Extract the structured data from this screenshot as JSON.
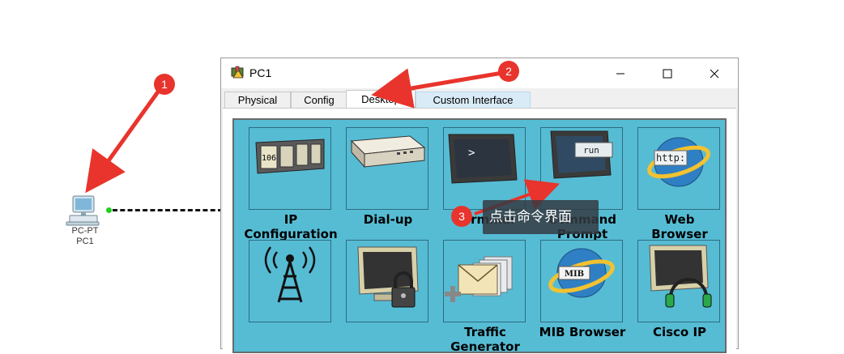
{
  "workspace": {
    "device_type": "PC-PT",
    "device_name": "PC1"
  },
  "window": {
    "title": "PC1",
    "tabs": [
      {
        "label": "Physical"
      },
      {
        "label": "Config"
      },
      {
        "label": "Desktop"
      },
      {
        "label": "Custom Interface"
      }
    ],
    "active_tab": "Desktop"
  },
  "desktop": {
    "apps": [
      {
        "label": "IP\nConfiguration",
        "icon": "ip-config-icon"
      },
      {
        "label": "Dial-up",
        "icon": "dialup-modem-icon"
      },
      {
        "label": "Terminal",
        "icon": "terminal-icon"
      },
      {
        "label": "Command\nPrompt",
        "icon": "command-prompt-icon",
        "icon_text": "run"
      },
      {
        "label": "Web\nBrowser",
        "icon": "web-browser-icon",
        "icon_text": "http:"
      },
      {
        "label": "",
        "icon": "wireless-antenna-icon"
      },
      {
        "label": "",
        "icon": "vpn-lock-icon"
      },
      {
        "label": "Traffic\nGenerator",
        "icon": "traffic-generator-icon"
      },
      {
        "label": "MIB Browser",
        "icon": "mib-browser-icon",
        "icon_text": "MIB"
      },
      {
        "label": "Cisco IP",
        "icon": "cisco-ip-phone-icon"
      }
    ],
    "ip_icon_text": "106",
    "terminal_icon_text": ">"
  },
  "annotations": {
    "badges": [
      "1",
      "2",
      "3"
    ],
    "tooltip": "点击命令界面",
    "color": "#e8342c"
  }
}
